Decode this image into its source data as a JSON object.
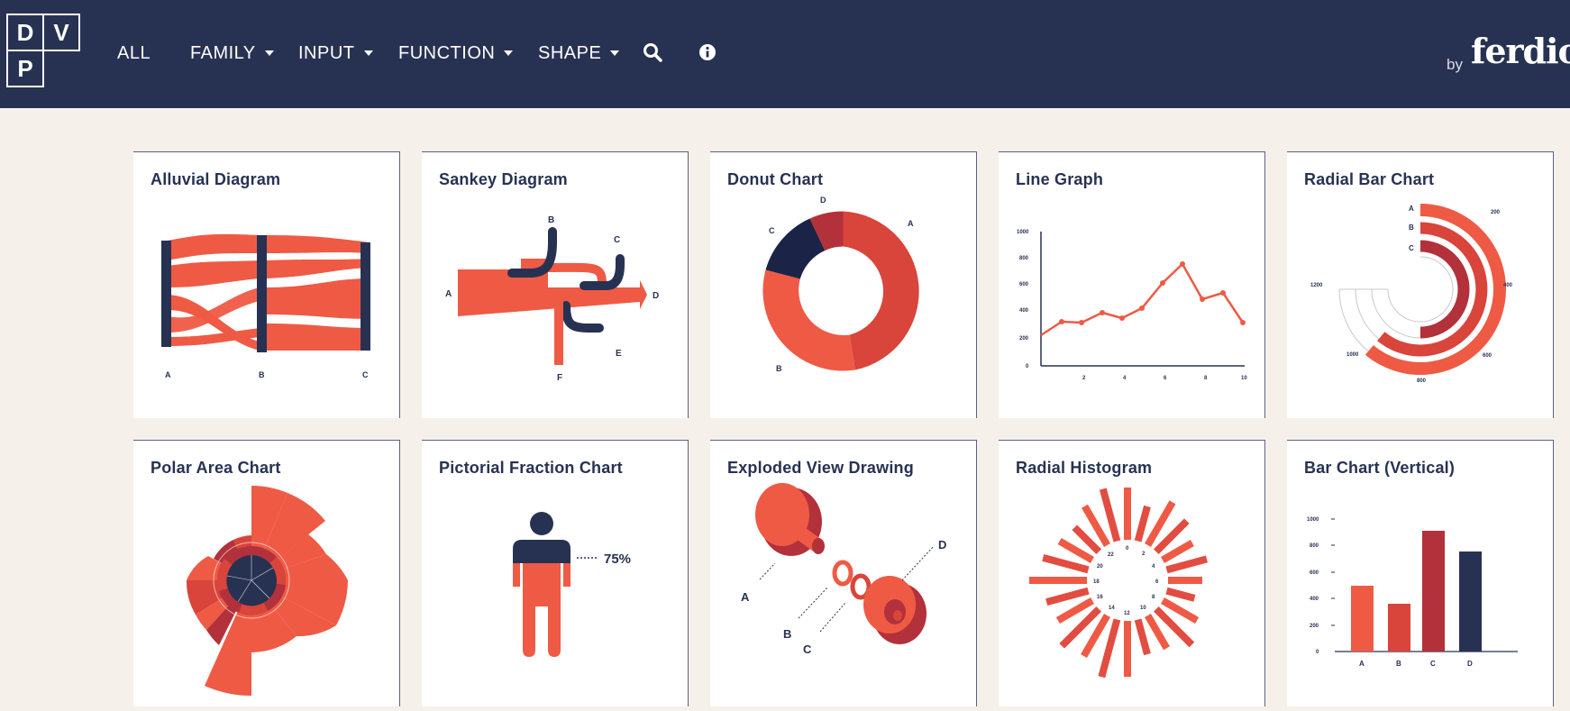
{
  "logo": {
    "letters": [
      "D",
      "V",
      "P"
    ]
  },
  "nav": {
    "items": [
      {
        "label": "ALL",
        "dropdown": false
      },
      {
        "label": "FAMILY",
        "dropdown": true
      },
      {
        "label": "INPUT",
        "dropdown": true
      },
      {
        "label": "FUNCTION",
        "dropdown": true
      },
      {
        "label": "SHAPE",
        "dropdown": true
      }
    ],
    "icons": [
      "search-icon",
      "info-icon"
    ]
  },
  "brand": {
    "by": "by",
    "name": "ferdio"
  },
  "colors": {
    "navy": "#273253",
    "coral": "#ef5a45",
    "red": "#d9443b",
    "darkred": "#b3313a",
    "background": "#f5f0ea"
  },
  "cards": [
    {
      "title": "Alluvial Diagram",
      "labels": [
        "A",
        "B",
        "C"
      ]
    },
    {
      "title": "Sankey Diagram",
      "labels": [
        "A",
        "B",
        "C",
        "D",
        "E",
        "F"
      ]
    },
    {
      "title": "Donut Chart",
      "labels": [
        "A",
        "B",
        "C",
        "D"
      ]
    },
    {
      "title": "Line Graph",
      "y_ticks": [
        "1000",
        "800",
        "600",
        "400",
        "200",
        "0"
      ],
      "x_ticks": [
        "2",
        "4",
        "6",
        "8",
        "10"
      ]
    },
    {
      "title": "Radial Bar Chart",
      "labels": [
        "A",
        "B",
        "C"
      ],
      "ticks": [
        "200",
        "400",
        "600",
        "800",
        "1000",
        "1200"
      ]
    },
    {
      "title": "Polar Area Chart"
    },
    {
      "title": "Pictorial Fraction Chart",
      "value": "75%"
    },
    {
      "title": "Exploded View Drawing",
      "labels": [
        "A",
        "B",
        "C",
        "D"
      ]
    },
    {
      "title": "Radial Histogram",
      "ticks": [
        "0",
        "2",
        "4",
        "6",
        "8",
        "10",
        "12",
        "14",
        "16",
        "18",
        "20",
        "22"
      ]
    },
    {
      "title": "Bar Chart (Vertical)",
      "y_ticks": [
        "1000",
        "800",
        "600",
        "400",
        "200",
        "0"
      ],
      "x_ticks": [
        "A",
        "B",
        "C",
        "D"
      ]
    }
  ]
}
